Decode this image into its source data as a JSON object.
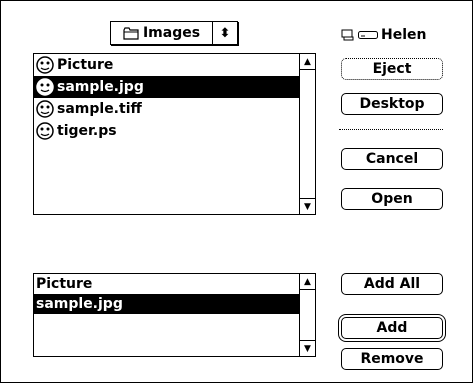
{
  "popup": {
    "folder_label": "Images",
    "arrows": "⬍"
  },
  "volume": {
    "name": "Helen"
  },
  "file_list": {
    "items": [
      {
        "label": "Picture",
        "selected": false
      },
      {
        "label": "sample.jpg",
        "selected": true
      },
      {
        "label": "sample.tiff",
        "selected": false
      },
      {
        "label": "tiger.ps",
        "selected": false
      }
    ]
  },
  "selected_list": {
    "items": [
      {
        "label": "Picture",
        "selected": false
      },
      {
        "label": "sample.jpg",
        "selected": true
      }
    ]
  },
  "buttons": {
    "eject": "Eject",
    "desktop": "Desktop",
    "cancel": "Cancel",
    "open": "Open",
    "add_all": "Add All",
    "add": "Add",
    "remove": "Remove"
  },
  "scroll": {
    "up": "▲",
    "down": "▼"
  }
}
